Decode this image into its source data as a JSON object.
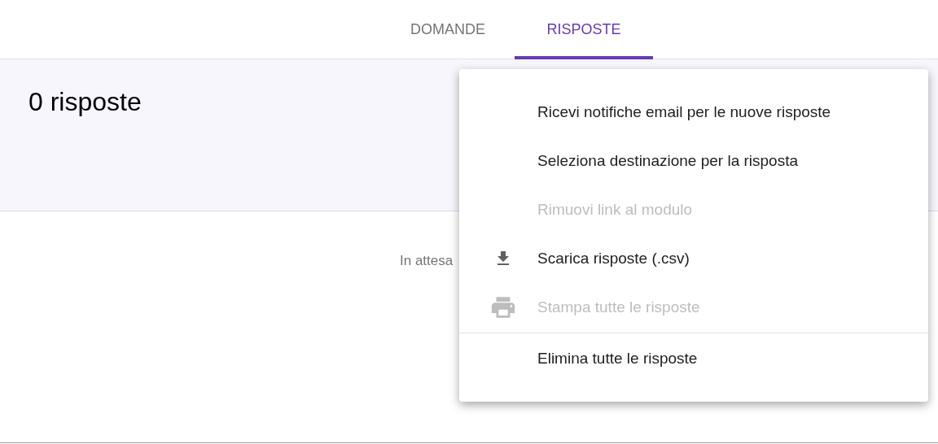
{
  "tabs": [
    {
      "label": "DOMANDE",
      "selected": false
    },
    {
      "label": "RISPOSTE",
      "selected": true
    }
  ],
  "summary": {
    "title": "0 risposte"
  },
  "status_text": "In attesa",
  "menu": {
    "sections": [
      {
        "items": [
          {
            "label": "Ricevi notifiche email per le nuove risposte",
            "kind": "text",
            "disabled": false
          },
          {
            "label": "Seleziona destinazione per la risposta",
            "kind": "text",
            "disabled": false
          },
          {
            "label": "Rimuovi link al modulo",
            "kind": "text",
            "disabled": true
          },
          {
            "label": "Scarica risposte (.csv)",
            "kind": "download",
            "disabled": false
          },
          {
            "label": "Stampa tutte le risposte",
            "kind": "print",
            "disabled": true
          }
        ]
      },
      {
        "items": [
          {
            "label": "Elimina tutte le risposte",
            "kind": "text",
            "disabled": false
          }
        ]
      }
    ]
  }
}
